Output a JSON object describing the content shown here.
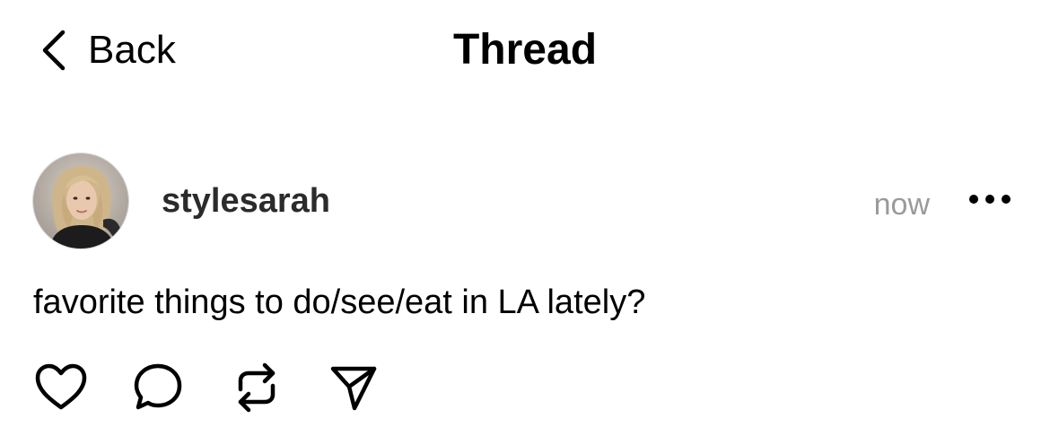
{
  "header": {
    "back_label": "Back",
    "title": "Thread"
  },
  "post": {
    "username": "stylesarah",
    "timestamp": "now",
    "text": "favorite things to do/see/eat in LA lately?",
    "avatar_icon": "profile-photo"
  },
  "actions": {
    "icons": [
      "heart-icon",
      "comment-icon",
      "repost-icon",
      "share-icon"
    ]
  },
  "colors": {
    "text": "#000000",
    "username": "#2b2b2b",
    "muted": "#9a9a9a",
    "background": "#ffffff"
  }
}
